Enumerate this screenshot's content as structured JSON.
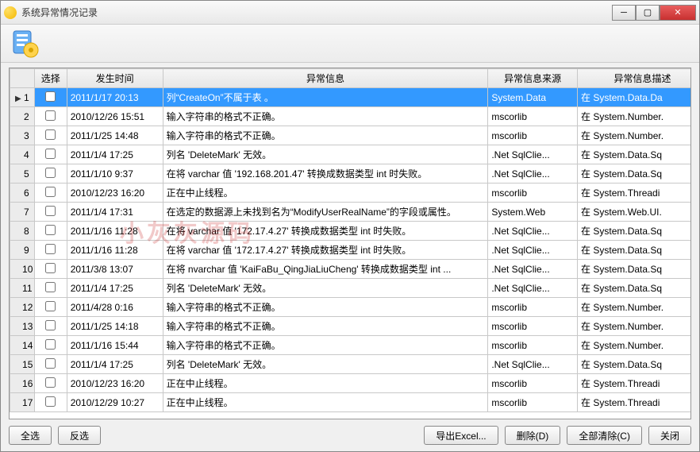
{
  "window": {
    "title": "系统异常情况记录"
  },
  "columns": {
    "rownum": "",
    "select": "选择",
    "time": "发生时间",
    "info": "异常信息",
    "source": "异常信息来源",
    "desc": "异常信息描述"
  },
  "rows": [
    {
      "n": "1",
      "time": "2011/1/17 20:13",
      "info": "列“CreateOn”不属于表 。",
      "src": "System.Data",
      "desc": "在 System.Data.Da",
      "selected": true
    },
    {
      "n": "2",
      "time": "2010/12/26 15:51",
      "info": "输入字符串的格式不正确。",
      "src": "mscorlib",
      "desc": "在 System.Number."
    },
    {
      "n": "3",
      "time": "2011/1/25 14:48",
      "info": "输入字符串的格式不正确。",
      "src": "mscorlib",
      "desc": "在 System.Number."
    },
    {
      "n": "4",
      "time": "2011/1/4 17:25",
      "info": "列名 'DeleteMark' 无效。",
      "src": ".Net SqlClie...",
      "desc": "在 System.Data.Sq"
    },
    {
      "n": "5",
      "time": "2011/1/10 9:37",
      "info": "在将 varchar 值 '192.168.201.47' 转换成数据类型 int 时失败。",
      "src": ".Net SqlClie...",
      "desc": "在 System.Data.Sq"
    },
    {
      "n": "6",
      "time": "2010/12/23 16:20",
      "info": "正在中止线程。",
      "src": "mscorlib",
      "desc": "在 System.Threadi"
    },
    {
      "n": "7",
      "time": "2011/1/4 17:31",
      "info": "在选定的数据源上未找到名为“ModifyUserRealName”的字段或属性。",
      "src": "System.Web",
      "desc": "在 System.Web.UI."
    },
    {
      "n": "8",
      "time": "2011/1/16 11:28",
      "info": "在将 varchar 值 '172.17.4.27' 转换成数据类型 int 时失败。",
      "src": ".Net SqlClie...",
      "desc": "在 System.Data.Sq"
    },
    {
      "n": "9",
      "time": "2011/1/16 11:28",
      "info": "在将 varchar 值 '172.17.4.27' 转换成数据类型 int 时失败。",
      "src": ".Net SqlClie...",
      "desc": "在 System.Data.Sq"
    },
    {
      "n": "10",
      "time": "2011/3/8 13:07",
      "info": "在将 nvarchar 值 'KaiFaBu_QingJiaLiuCheng' 转换成数据类型 int ...",
      "src": ".Net SqlClie...",
      "desc": "在 System.Data.Sq"
    },
    {
      "n": "11",
      "time": "2011/1/4 17:25",
      "info": "列名 'DeleteMark' 无效。",
      "src": ".Net SqlClie...",
      "desc": "在 System.Data.Sq"
    },
    {
      "n": "12",
      "time": "2011/4/28 0:16",
      "info": "输入字符串的格式不正确。",
      "src": "mscorlib",
      "desc": "在 System.Number."
    },
    {
      "n": "13",
      "time": "2011/1/25 14:18",
      "info": "输入字符串的格式不正确。",
      "src": "mscorlib",
      "desc": "在 System.Number."
    },
    {
      "n": "14",
      "time": "2011/1/16 15:44",
      "info": "输入字符串的格式不正确。",
      "src": "mscorlib",
      "desc": "在 System.Number."
    },
    {
      "n": "15",
      "time": "2011/1/4 17:25",
      "info": "列名 'DeleteMark' 无效。",
      "src": ".Net SqlClie...",
      "desc": "在 System.Data.Sq"
    },
    {
      "n": "16",
      "time": "2010/12/23 16:20",
      "info": "正在中止线程。",
      "src": "mscorlib",
      "desc": "在 System.Threadi"
    },
    {
      "n": "17",
      "time": "2010/12/29 10:27",
      "info": "正在中止线程。",
      "src": "mscorlib",
      "desc": "在 System.Threadi"
    }
  ],
  "buttons": {
    "select_all": "全选",
    "invert": "反选",
    "export": "导出Excel...",
    "delete": "删除(D)",
    "clear_all": "全部清除(C)",
    "close": "关闭"
  },
  "watermark": "小灰灰源码"
}
